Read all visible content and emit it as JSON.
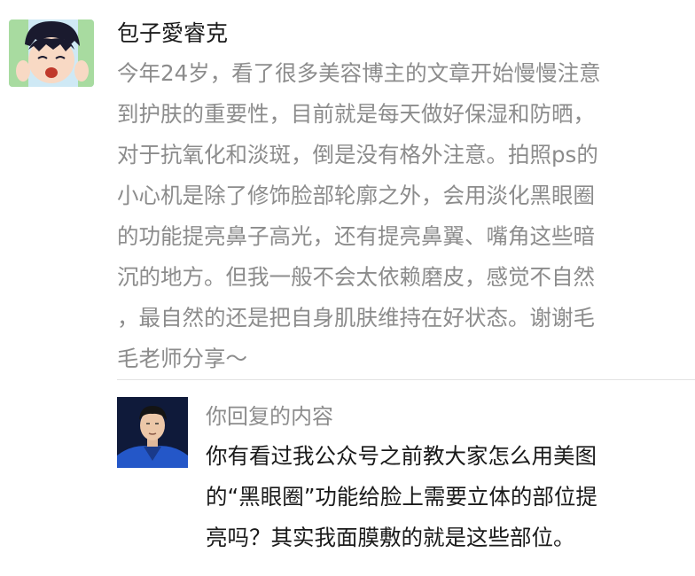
{
  "comment": {
    "author": "包子愛睿克",
    "avatar_icon": "cartoon-avatar-icon",
    "lines": [
      "今年24岁，看了很多美容博主的文章开始慢慢注意",
      "到护肤的重要性，目前就是每天做好保湿和防晒，",
      "对于抗氧化和淡斑，倒是没有格外注意。拍照ps的",
      "小心机是除了修饰脸部轮廓之外，会用淡化黑眼圈",
      "的功能提亮鼻子高光，还有提亮鼻翼、嘴角这些暗",
      "沉的地方。但我一般不会太依赖磨皮，感觉不自然",
      "，最自然的还是把自身肌肤维持在好状态。谢谢毛",
      "毛老师分享～"
    ]
  },
  "reply": {
    "label": "你回复的内容",
    "avatar_icon": "author-photo-avatar-icon",
    "lines": [
      "你有看过我公众号之前教大家怎么用美图",
      "的“黑眼圈”功能给脸上需要立体的部位提",
      "亮吗？其实我面膜敷的就是这些部位。"
    ]
  }
}
